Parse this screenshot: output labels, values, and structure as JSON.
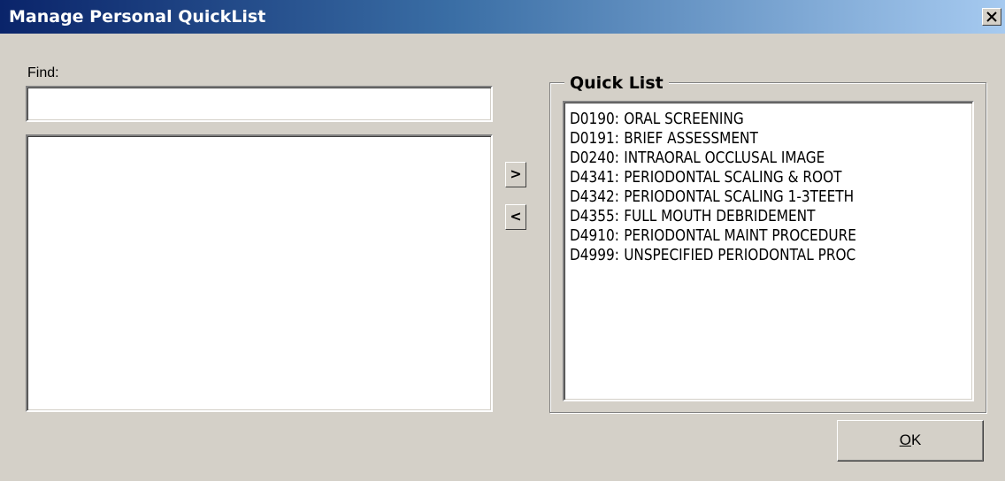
{
  "window": {
    "title": "Manage Personal QuickList"
  },
  "find": {
    "label": "Find:",
    "value": "",
    "placeholder": ""
  },
  "available_list": {
    "items": []
  },
  "move_buttons": {
    "add_label": ">",
    "remove_label": "<"
  },
  "quick_list": {
    "title": "Quick List",
    "items": [
      {
        "code": "D0190:",
        "desc": "ORAL SCREENING"
      },
      {
        "code": "D0191:",
        "desc": "BRIEF ASSESSMENT"
      },
      {
        "code": "D0240:",
        "desc": "INTRAORAL OCCLUSAL IMAGE"
      },
      {
        "code": "D4341:",
        "desc": "PERIODONTAL SCALING & ROOT"
      },
      {
        "code": "D4342:",
        "desc": "PERIODONTAL SCALING 1-3TEETH"
      },
      {
        "code": "D4355:",
        "desc": "FULL MOUTH DEBRIDEMENT"
      },
      {
        "code": "D4910:",
        "desc": "PERIODONTAL MAINT PROCEDURE"
      },
      {
        "code": "D4999:",
        "desc": "UNSPECIFIED PERIODONTAL PROC"
      }
    ]
  },
  "ok_button": {
    "mnemonic": "O",
    "rest": "K"
  }
}
